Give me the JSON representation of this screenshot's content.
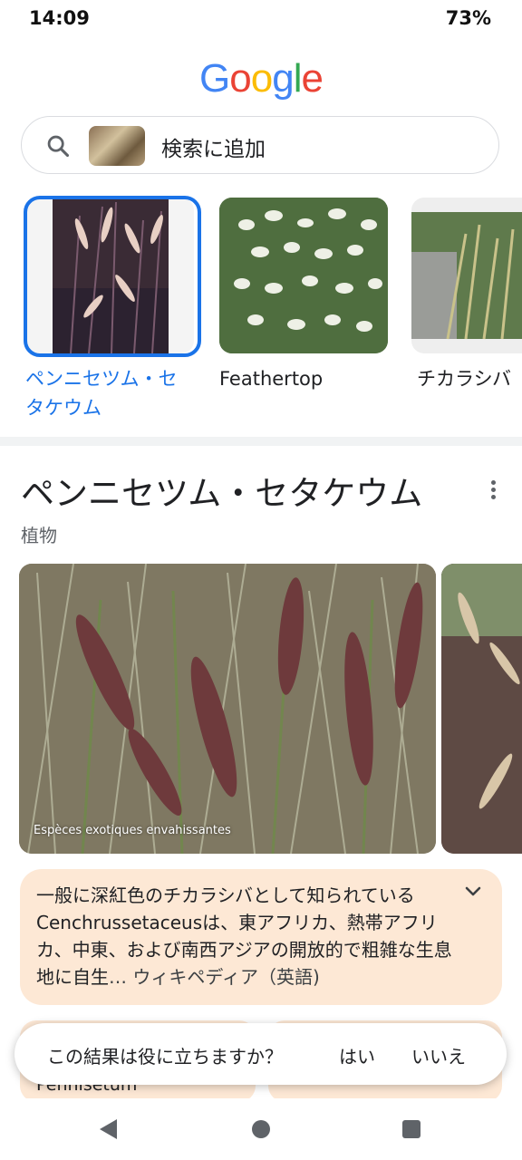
{
  "status": {
    "time": "14:09",
    "battery": "73%"
  },
  "logo": {
    "letters": [
      "G",
      "o",
      "o",
      "g",
      "l",
      "e"
    ],
    "colors": [
      "#4285F4",
      "#EA4335",
      "#FBBC05",
      "#4285F4",
      "#34A853",
      "#EA4335"
    ]
  },
  "search": {
    "icon": "search-icon",
    "text": "検索に追加"
  },
  "suggestions": [
    {
      "label": "ペンニセツム・セタケウム",
      "selected": true
    },
    {
      "label": "Feathertop",
      "selected": false
    },
    {
      "label": "チカラシバ",
      "selected": false
    }
  ],
  "knowledge_panel": {
    "title": "ペンニセツム・セタケウム",
    "subtitle": "植物",
    "image_caption": "Espèces exotiques envahissantes",
    "description": "一般に深紅色のチカラシバとして知られているCenchrussetaceusは、東アフリカ、熱帯アフリカ、中東、および南西アジアの開放的で粗雑な生息地に自生",
    "source": "… ウィキペディア（英語)"
  },
  "bottom_card_label": "Pennisetum",
  "feedback": {
    "question": "この結果は役に立ちますか？",
    "yes": "はい",
    "no": "いいえ"
  },
  "colors": {
    "accent": "#1a73e8",
    "panel_bg": "#fde8d5"
  }
}
